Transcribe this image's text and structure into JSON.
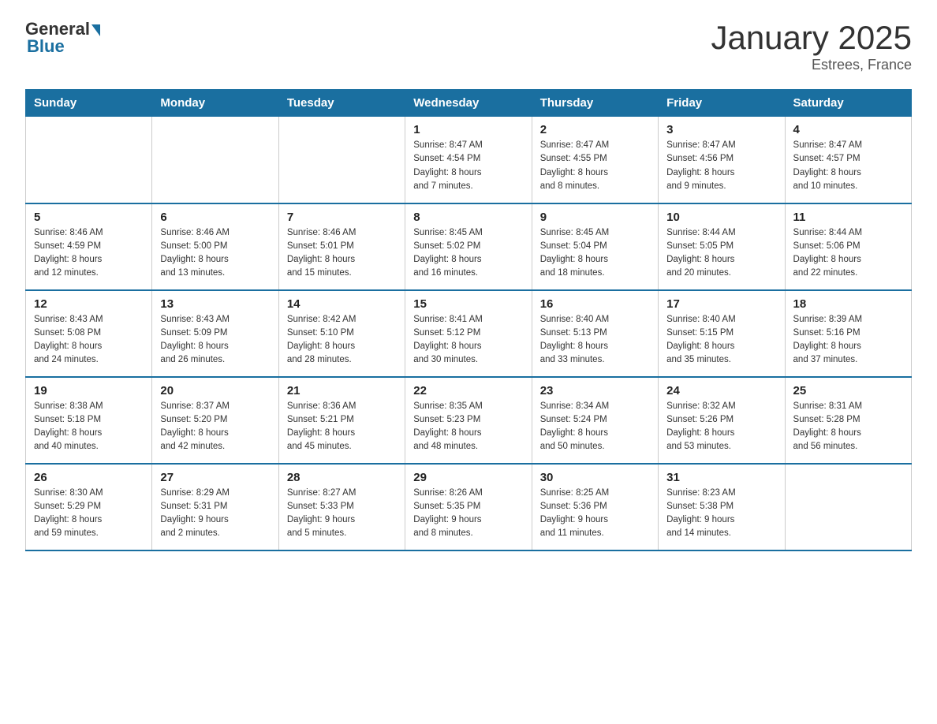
{
  "header": {
    "logo_general": "General",
    "logo_blue": "Blue",
    "title": "January 2025",
    "location": "Estrees, France"
  },
  "days_of_week": [
    "Sunday",
    "Monday",
    "Tuesday",
    "Wednesday",
    "Thursday",
    "Friday",
    "Saturday"
  ],
  "weeks": [
    [
      {
        "day": "",
        "info": ""
      },
      {
        "day": "",
        "info": ""
      },
      {
        "day": "",
        "info": ""
      },
      {
        "day": "1",
        "info": "Sunrise: 8:47 AM\nSunset: 4:54 PM\nDaylight: 8 hours\nand 7 minutes."
      },
      {
        "day": "2",
        "info": "Sunrise: 8:47 AM\nSunset: 4:55 PM\nDaylight: 8 hours\nand 8 minutes."
      },
      {
        "day": "3",
        "info": "Sunrise: 8:47 AM\nSunset: 4:56 PM\nDaylight: 8 hours\nand 9 minutes."
      },
      {
        "day": "4",
        "info": "Sunrise: 8:47 AM\nSunset: 4:57 PM\nDaylight: 8 hours\nand 10 minutes."
      }
    ],
    [
      {
        "day": "5",
        "info": "Sunrise: 8:46 AM\nSunset: 4:59 PM\nDaylight: 8 hours\nand 12 minutes."
      },
      {
        "day": "6",
        "info": "Sunrise: 8:46 AM\nSunset: 5:00 PM\nDaylight: 8 hours\nand 13 minutes."
      },
      {
        "day": "7",
        "info": "Sunrise: 8:46 AM\nSunset: 5:01 PM\nDaylight: 8 hours\nand 15 minutes."
      },
      {
        "day": "8",
        "info": "Sunrise: 8:45 AM\nSunset: 5:02 PM\nDaylight: 8 hours\nand 16 minutes."
      },
      {
        "day": "9",
        "info": "Sunrise: 8:45 AM\nSunset: 5:04 PM\nDaylight: 8 hours\nand 18 minutes."
      },
      {
        "day": "10",
        "info": "Sunrise: 8:44 AM\nSunset: 5:05 PM\nDaylight: 8 hours\nand 20 minutes."
      },
      {
        "day": "11",
        "info": "Sunrise: 8:44 AM\nSunset: 5:06 PM\nDaylight: 8 hours\nand 22 minutes."
      }
    ],
    [
      {
        "day": "12",
        "info": "Sunrise: 8:43 AM\nSunset: 5:08 PM\nDaylight: 8 hours\nand 24 minutes."
      },
      {
        "day": "13",
        "info": "Sunrise: 8:43 AM\nSunset: 5:09 PM\nDaylight: 8 hours\nand 26 minutes."
      },
      {
        "day": "14",
        "info": "Sunrise: 8:42 AM\nSunset: 5:10 PM\nDaylight: 8 hours\nand 28 minutes."
      },
      {
        "day": "15",
        "info": "Sunrise: 8:41 AM\nSunset: 5:12 PM\nDaylight: 8 hours\nand 30 minutes."
      },
      {
        "day": "16",
        "info": "Sunrise: 8:40 AM\nSunset: 5:13 PM\nDaylight: 8 hours\nand 33 minutes."
      },
      {
        "day": "17",
        "info": "Sunrise: 8:40 AM\nSunset: 5:15 PM\nDaylight: 8 hours\nand 35 minutes."
      },
      {
        "day": "18",
        "info": "Sunrise: 8:39 AM\nSunset: 5:16 PM\nDaylight: 8 hours\nand 37 minutes."
      }
    ],
    [
      {
        "day": "19",
        "info": "Sunrise: 8:38 AM\nSunset: 5:18 PM\nDaylight: 8 hours\nand 40 minutes."
      },
      {
        "day": "20",
        "info": "Sunrise: 8:37 AM\nSunset: 5:20 PM\nDaylight: 8 hours\nand 42 minutes."
      },
      {
        "day": "21",
        "info": "Sunrise: 8:36 AM\nSunset: 5:21 PM\nDaylight: 8 hours\nand 45 minutes."
      },
      {
        "day": "22",
        "info": "Sunrise: 8:35 AM\nSunset: 5:23 PM\nDaylight: 8 hours\nand 48 minutes."
      },
      {
        "day": "23",
        "info": "Sunrise: 8:34 AM\nSunset: 5:24 PM\nDaylight: 8 hours\nand 50 minutes."
      },
      {
        "day": "24",
        "info": "Sunrise: 8:32 AM\nSunset: 5:26 PM\nDaylight: 8 hours\nand 53 minutes."
      },
      {
        "day": "25",
        "info": "Sunrise: 8:31 AM\nSunset: 5:28 PM\nDaylight: 8 hours\nand 56 minutes."
      }
    ],
    [
      {
        "day": "26",
        "info": "Sunrise: 8:30 AM\nSunset: 5:29 PM\nDaylight: 8 hours\nand 59 minutes."
      },
      {
        "day": "27",
        "info": "Sunrise: 8:29 AM\nSunset: 5:31 PM\nDaylight: 9 hours\nand 2 minutes."
      },
      {
        "day": "28",
        "info": "Sunrise: 8:27 AM\nSunset: 5:33 PM\nDaylight: 9 hours\nand 5 minutes."
      },
      {
        "day": "29",
        "info": "Sunrise: 8:26 AM\nSunset: 5:35 PM\nDaylight: 9 hours\nand 8 minutes."
      },
      {
        "day": "30",
        "info": "Sunrise: 8:25 AM\nSunset: 5:36 PM\nDaylight: 9 hours\nand 11 minutes."
      },
      {
        "day": "31",
        "info": "Sunrise: 8:23 AM\nSunset: 5:38 PM\nDaylight: 9 hours\nand 14 minutes."
      },
      {
        "day": "",
        "info": ""
      }
    ]
  ]
}
